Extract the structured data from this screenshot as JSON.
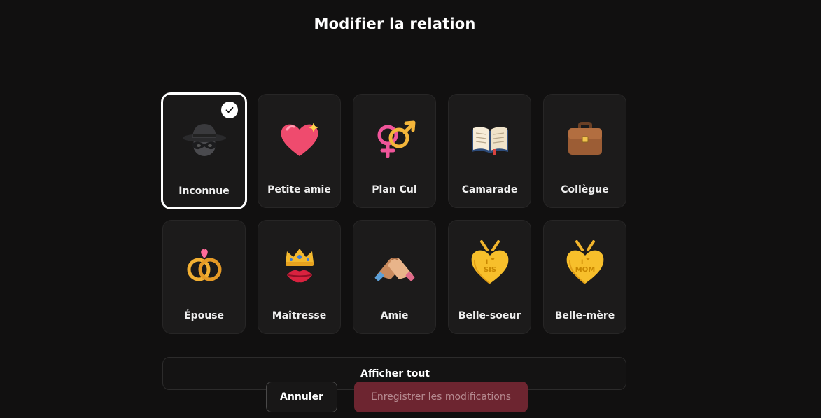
{
  "title": "Modifier la relation",
  "relations": [
    {
      "label": "Inconnue",
      "icon": "spy-icon",
      "selected": true
    },
    {
      "label": "Petite amie",
      "icon": "heart-icon"
    },
    {
      "label": "Plan Cul",
      "icon": "gender-symbols-icon"
    },
    {
      "label": "Camarade",
      "icon": "open-book-icon"
    },
    {
      "label": "Collègue",
      "icon": "briefcase-icon"
    },
    {
      "label": "Épouse",
      "icon": "wedding-rings-icon"
    },
    {
      "label": "Maîtresse",
      "icon": "crown-lips-icon"
    },
    {
      "label": "Amie",
      "icon": "handshake-icon"
    },
    {
      "label": "Belle-soeur",
      "icon": "sis-heart-pendant-icon",
      "text_line1": "I",
      "text_line2": "SIS"
    },
    {
      "label": "Belle-mère",
      "icon": "mom-heart-pendant-icon",
      "text_line1": "I",
      "text_line2": "MOM"
    }
  ],
  "show_all_label": "Afficher tout",
  "cancel_label": "Annuler",
  "save_label": "Enregistrer les modifications",
  "colors": {
    "background": "#111010",
    "card": "#1c1b1b",
    "save_button": "#6d2530",
    "save_text": "#b68a90",
    "selected_border": "#ffffff"
  }
}
